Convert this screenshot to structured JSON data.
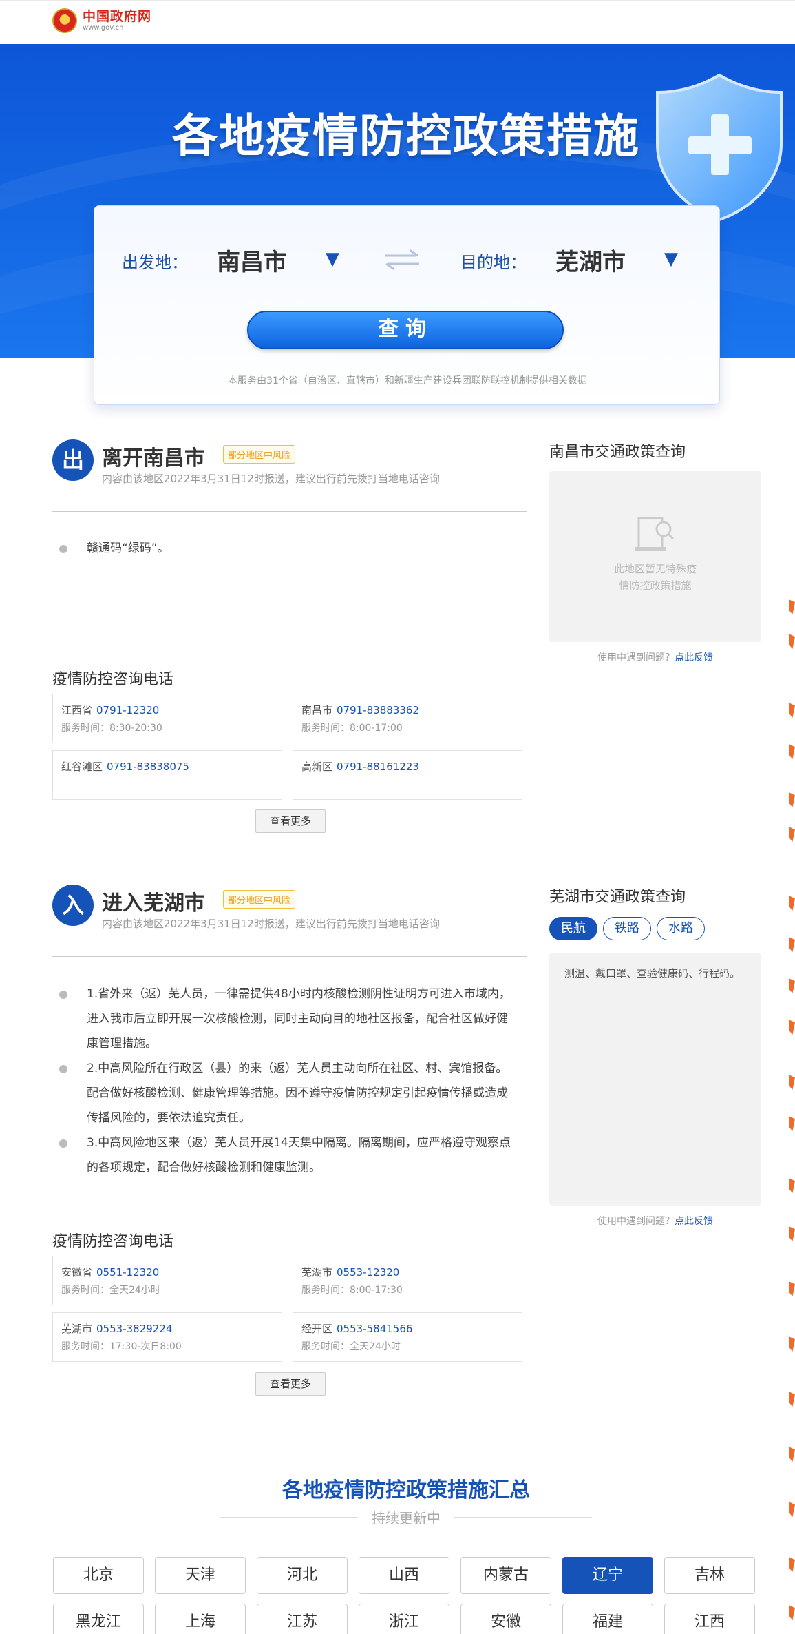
{
  "header": {
    "site_title": "中国政府网",
    "site_url": "www.gov.cn"
  },
  "banner": {
    "title": "各地疫情防控政策措施"
  },
  "search": {
    "from_label": "出发地：",
    "from_city": "南昌市",
    "to_label": "目的地：",
    "to_city": "芜湖市",
    "dropdown_glyph": "▼",
    "query_label": "查询",
    "note": "本服务由31个省（自治区、直辖市）和新疆生产建设兵团联防联控机制提供相关数据"
  },
  "leave": {
    "badge": "出",
    "title": "离开南昌市",
    "risk": "部分地区中风险",
    "subtitle": "内容由该地区2022年3月31日12时报送，建议出行前先拨打当地电话咨询",
    "items": [
      "赣通码“绿码”。"
    ],
    "phone_title": "疫情防控咨询电话",
    "phones": [
      {
        "area": "江西省",
        "number": "0791-12320",
        "time": "服务时间：8:30-20:30"
      },
      {
        "area": "南昌市",
        "number": "0791-83883362",
        "time": "服务时间：8:00-17:00"
      },
      {
        "area": "红谷滩区",
        "number": "0791-83838075",
        "time": ""
      },
      {
        "area": "高新区",
        "number": "0791-88161223",
        "time": ""
      }
    ],
    "more_label": "查看更多",
    "side_title": "南昌市交通政策查询",
    "side_empty": [
      "此地区暂无特殊疫",
      "情防控政策措施"
    ],
    "feedback_prefix": "使用中遇到问题？",
    "feedback_link": "点此反馈"
  },
  "enter": {
    "badge": "入",
    "title": "进入芜湖市",
    "risk": "部分地区中风险",
    "subtitle": "内容由该地区2022年3月31日12时报送，建议出行前先拨打当地电话咨询",
    "items": [
      "1.省外来（返）芜人员，一律需提供48小时内核酸检测阴性证明方可进入市域内，进入我市后立即开展一次核酸检测，同时主动向目的地社区报备，配合社区做好健康管理措施。",
      "2.中高风险所在行政区（县）的来（返）芜人员主动向所在社区、村、宾馆报备。配合做好核酸检测、健康管理等措施。因不遵守疫情防控规定引起疫情传播或造成传播风险的，要依法追究责任。",
      "3.中高风险地区来（返）芜人员开展14天集中隔离。隔离期间，应严格遵守观察点的各项规定，配合做好核酸检测和健康监测。"
    ],
    "phone_title": "疫情防控咨询电话",
    "phones": [
      {
        "area": "安徽省",
        "number": "0551-12320",
        "time": "服务时间：全天24小时"
      },
      {
        "area": "芜湖市",
        "number": "0553-12320",
        "time": "服务时间：8:00-17:30"
      },
      {
        "area": "芜湖市",
        "number": "0553-3829224",
        "time": "服务时间：17:30-次日8:00"
      },
      {
        "area": "经开区",
        "number": "0553-5841566",
        "time": "服务时间：全天24小时"
      }
    ],
    "more_label": "查看更多",
    "side_title": "芜湖市交通政策查询",
    "modes": [
      "民航",
      "铁路",
      "水路"
    ],
    "active_mode": "民航",
    "policy_text": "测温、戴口罩、查验健康码、行程码。",
    "feedback_prefix": "使用中遇到问题？",
    "feedback_link": "点此反馈"
  },
  "summary": {
    "title": "各地疫情防控政策措施汇总",
    "subtitle": "持续更新中",
    "provinces_row1": [
      "北京",
      "天津",
      "河北",
      "山西",
      "内蒙古",
      "辽宁",
      "吉林"
    ],
    "provinces_row2": [
      "黑龙江",
      "上海",
      "江苏",
      "浙江",
      "安徽",
      "福建",
      "江西"
    ],
    "active_province": "辽宁"
  },
  "colors": {
    "primary": "#1553b8",
    "banner": "#1467e3",
    "risk": "#f0a020",
    "brand_red": "#d8261e"
  }
}
